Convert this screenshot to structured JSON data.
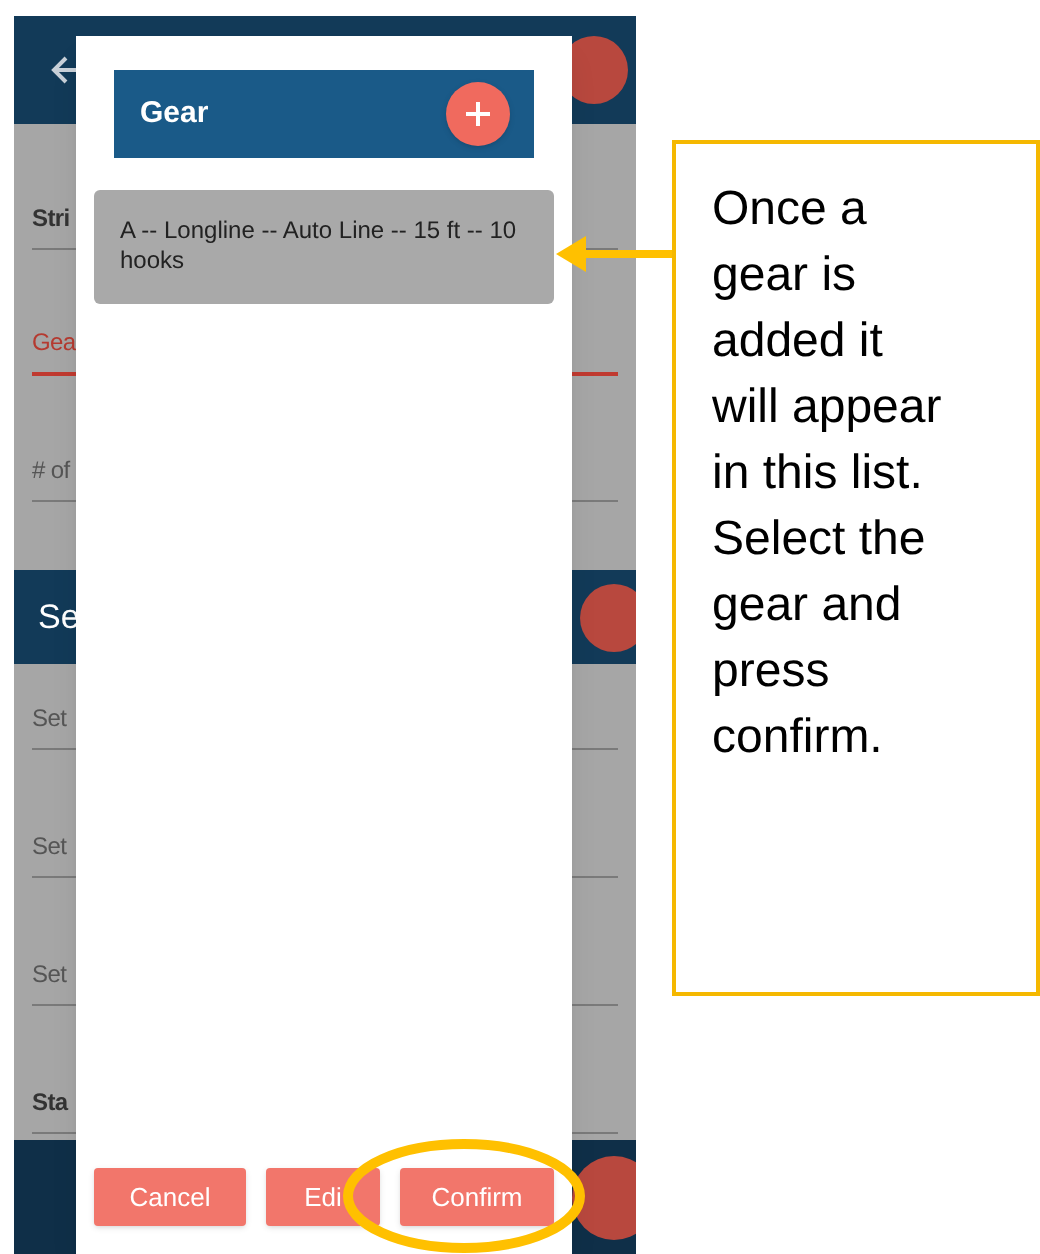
{
  "background_screen": {
    "fields": [
      {
        "label": "Stri",
        "kind": "bold"
      },
      {
        "label": "Gea",
        "kind": "active"
      },
      {
        "label": "# of",
        "kind": "plain"
      }
    ],
    "section_bar": {
      "title": "Se"
    },
    "fields_2": [
      {
        "label": "Set",
        "kind": "plain"
      },
      {
        "label": "Set",
        "kind": "plain"
      },
      {
        "label": "Set",
        "kind": "plain"
      },
      {
        "label": "Sta",
        "kind": "bold"
      }
    ]
  },
  "dialog": {
    "title": "Gear",
    "items": [
      {
        "text": "A -- Longline -- Auto Line -- 15 ft -- 10 hooks"
      }
    ],
    "buttons": [
      {
        "label": "Cancel"
      },
      {
        "label": "Edi"
      },
      {
        "label": "Confirm"
      }
    ]
  },
  "callout": {
    "text": "Once a\ngear is\nadded it\nwill appear\nin this list.\nSelect the\ngear and\npress\nconfirm."
  }
}
